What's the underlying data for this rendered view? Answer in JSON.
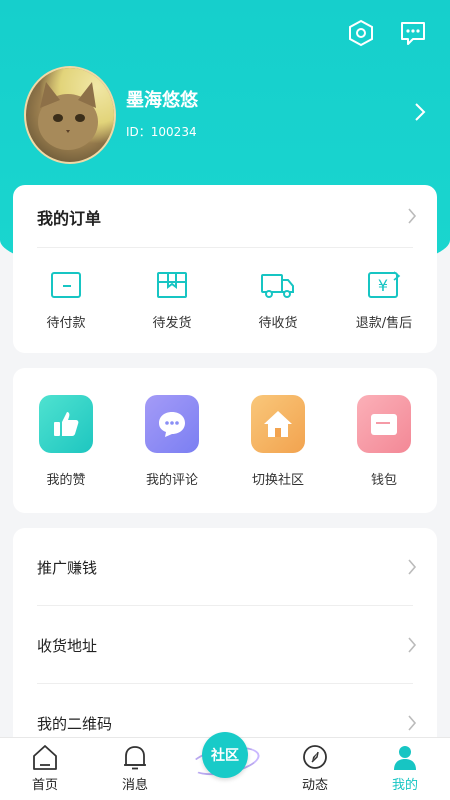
{
  "header": {
    "settings_icon": "settings-hexagon-icon",
    "message_icon": "message-icon"
  },
  "profile": {
    "username": "墨海悠悠",
    "id_text": "ID：100234"
  },
  "orders": {
    "title": "我的订单",
    "items": [
      {
        "label": "待付款",
        "icon": "wallet-icon"
      },
      {
        "label": "待发货",
        "icon": "box-icon"
      },
      {
        "label": "待收货",
        "icon": "truck-icon"
      },
      {
        "label": "退款/售后",
        "icon": "refund-icon"
      }
    ]
  },
  "features": {
    "items": [
      {
        "label": "我的赞",
        "icon": "thumbs-up-icon",
        "color": "#2ed5c9"
      },
      {
        "label": "我的评论",
        "icon": "comment-icon",
        "color": "#8a8ff5"
      },
      {
        "label": "切换社区",
        "icon": "home-icon",
        "color": "#f6b463"
      },
      {
        "label": "钱包",
        "icon": "wallet-icon",
        "color": "#f59aa6"
      }
    ]
  },
  "menu": {
    "items": [
      {
        "label": "推广赚钱"
      },
      {
        "label": "收货地址"
      },
      {
        "label": "我的二维码"
      }
    ]
  },
  "tabbar": {
    "items": [
      {
        "label": "首页",
        "icon": "home-icon"
      },
      {
        "label": "消息",
        "icon": "bell-icon"
      },
      {
        "label": "社区",
        "icon": "community-planet-icon"
      },
      {
        "label": "动态",
        "icon": "compass-icon"
      },
      {
        "label": "我的",
        "icon": "user-icon"
      }
    ],
    "active": "我的"
  },
  "colors": {
    "accent": "#17c5c3",
    "header": "#16cfcc"
  }
}
